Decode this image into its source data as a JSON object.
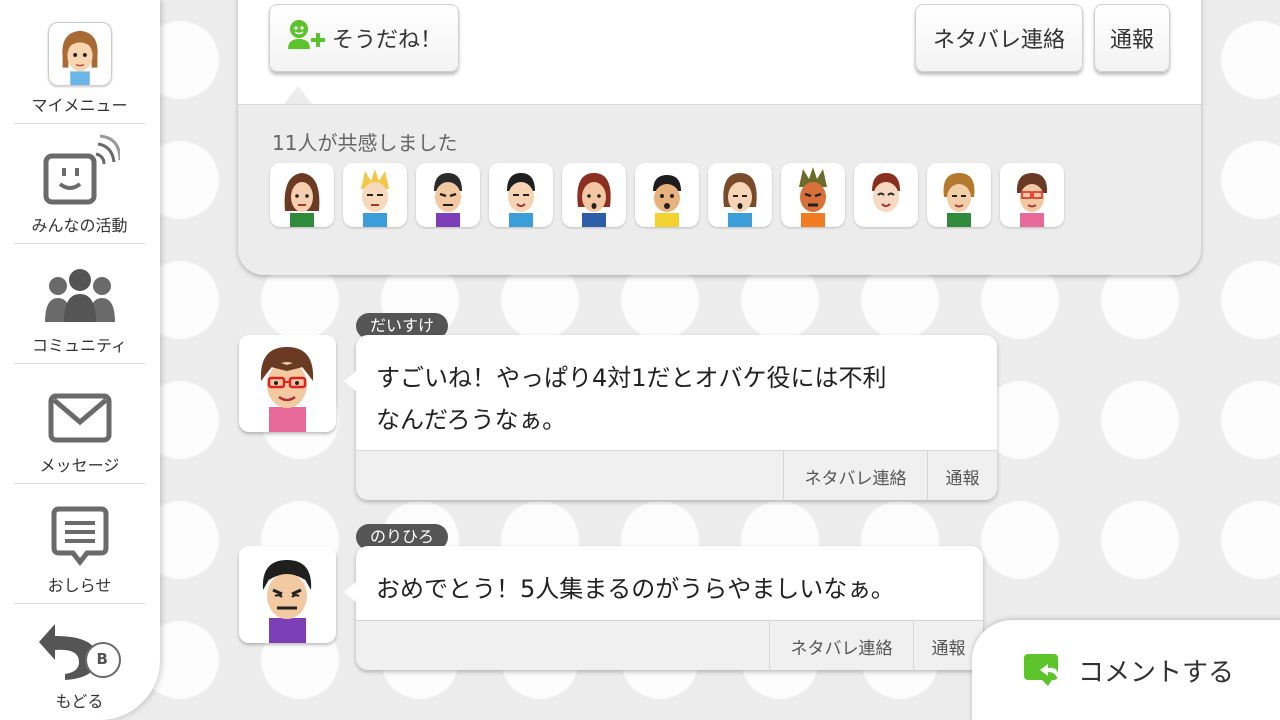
{
  "sidebar": {
    "items": [
      {
        "label": "マイメニュー",
        "icon": "my-mii-avatar"
      },
      {
        "label": "みんなの活動",
        "icon": "activity-feed-icon"
      },
      {
        "label": "コミュニティ",
        "icon": "community-icon"
      },
      {
        "label": "メッセージ",
        "icon": "envelope-icon"
      },
      {
        "label": "おしらせ",
        "icon": "notification-icon"
      },
      {
        "label": "もどる",
        "icon": "back-arrow-icon",
        "badge": "B"
      }
    ]
  },
  "post": {
    "yeah_label": "そうだね！",
    "spoiler_label": "ネタバレ連絡",
    "report_label": "通報",
    "yeah_count_text": "11人が共感しました",
    "yeah_icon_color": "#5cc32b"
  },
  "comments": [
    {
      "username": "だいすけ",
      "line1": "すごいね！やっぱり4対1だとオバケ役には不利",
      "line2": "なんだろうなぁ。",
      "spoiler_label": "ネタバレ連絡",
      "report_label": "通報"
    },
    {
      "username": "のりひろ",
      "line1": "おめでとう！5人集まるのがうらやましいなぁ。",
      "spoiler_label": "ネタバレ連絡",
      "report_label": "通報"
    }
  ],
  "comment_button": {
    "label": "コメントする",
    "icon_color": "#5cc32b"
  },
  "colors": {
    "background": "#ececec",
    "card": "#ffffff",
    "name_tag": "#555555",
    "accent_green": "#5cc32b"
  }
}
